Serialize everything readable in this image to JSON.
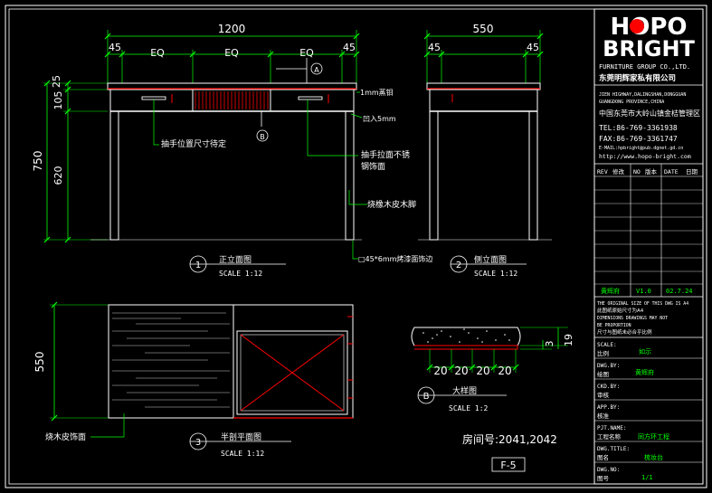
{
  "colors": {
    "bg": "#000000",
    "frame": "#ffffff",
    "dim": "#00ff00",
    "line": "#ffffff",
    "accent": "#ff0000",
    "yellow": "#ffff00",
    "cyan": "#00ffff",
    "titleblock_text": "#ffffff"
  },
  "front_view": {
    "overall_width": "1200",
    "dims_top": [
      "45",
      "EQ",
      "EQ",
      "EQ",
      "45"
    ],
    "dims_left": [
      "25",
      "105",
      "750",
      "620"
    ],
    "callouts": {
      "handle": "抽手位置尺寸待定",
      "handle_material": "抽手拉面不锈",
      "handle_material2": "钢饰面",
      "edge": "1mm蒸钼",
      "recess": "凹入5mm",
      "leg_finish": "烧橡木皮木脚",
      "rim": "□45*6mm烤漆面饰边"
    },
    "section_a": "A",
    "section_b": "B",
    "view_num": "1",
    "view_title": "正立面图",
    "view_scale": "SCALE 1:12"
  },
  "side_view": {
    "width": "550",
    "dims": [
      "45",
      "45"
    ],
    "view_num": "2",
    "view_title": "侧立面图",
    "view_scale": "SCALE 1:12"
  },
  "plan_view": {
    "depth": "550",
    "callout": "烧木皮饰面",
    "view_num": "3",
    "view_title": "半剖平面图",
    "view_scale": "SCALE 1:12"
  },
  "detail": {
    "dims": [
      "20",
      "20",
      "20",
      "20"
    ],
    "right_dims": [
      "3",
      "19"
    ],
    "view_num": "B",
    "view_title": "大样图",
    "view_scale": "SCALE 1:2"
  },
  "room": "房间号:2041,2042",
  "sheet_id": "F-5",
  "title_block": {
    "logo_top": "HOPO",
    "logo_bottom": "BRIGHT",
    "company_en": "FURNITURE GROUP CO.,LTD.",
    "company_cn": "东莞明辉家私有限公司",
    "address_en": [
      "JIEN HIGHWAY,DALINGSHAN,DONGGUAN",
      "GUANGDONG PROVINCE,CHINA"
    ],
    "address_cn": "中国东莞市大岭山镇金桔管理区",
    "tel": "TEL:86-769-3361938",
    "fax": "FAX:86-769-3361747",
    "email": "E-MAIL:hpbright@pub.dgnet.gd.cn",
    "web": "http://www.hopo-bright.com",
    "rev_headers": [
      "REV",
      "修改",
      "NO",
      "版本",
      "DATE",
      "日期"
    ],
    "rev_row": [
      "黄辉府",
      "V1.0",
      "02.7.24"
    ],
    "notes": [
      "THE ORIGINAL SIZE OF THIS DWG IS A4",
      "此图纸原始尺寸为A4",
      "DIMENSIONS DRAWINGS MAY NOT",
      "BE PROPORTION",
      "尺寸与图纸未必合乎比例"
    ],
    "fields": [
      {
        "en": "SCALE:",
        "cn": "比例",
        "value": "如示"
      },
      {
        "en": "DWG.BY:",
        "cn": "绘图",
        "value": "黄辉府"
      },
      {
        "en": "CKD.BY:",
        "cn": "审核",
        "value": ""
      },
      {
        "en": "APP.BY:",
        "cn": "核准",
        "value": ""
      },
      {
        "en": "PJT.NAME:",
        "cn": "工程名称",
        "value": "同方环工程"
      },
      {
        "en": "DWG.TITLE:",
        "cn": "图名",
        "value": "梳妆台"
      },
      {
        "en": "DWG.NO:",
        "cn": "图号",
        "value": "1/1"
      }
    ]
  }
}
